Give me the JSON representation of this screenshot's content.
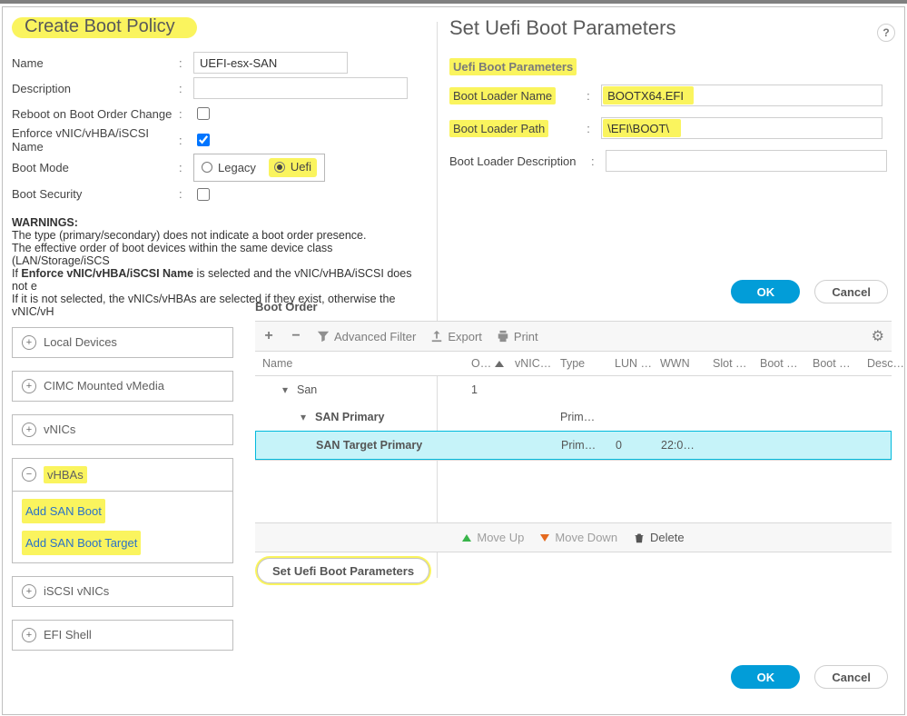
{
  "left": {
    "title": "Create Boot Policy",
    "fields": {
      "name_label": "Name",
      "name_value": "UEFI-esx-SAN",
      "desc_label": "Description",
      "desc_value": "",
      "reboot_label": "Reboot on Boot Order Change",
      "enforce_label": "Enforce vNIC/vHBA/iSCSI Name",
      "bootmode_label": "Boot Mode",
      "bootmode_legacy": "Legacy",
      "bootmode_uefi": "Uefi",
      "bootsec_label": "Boot Security"
    },
    "warnings": {
      "heading": "WARNINGS:",
      "l1": "The type (primary/secondary) does not indicate a boot order presence.",
      "l2": "The effective order of boot devices within the same device class (LAN/Storage/iSCS",
      "l3": "If Enforce vNIC/vHBA/iSCSI Name is selected and the vNIC/vHBA/iSCSI does not e",
      "l4": "If it is not selected, the vNICs/vHBAs are selected if they exist, otherwise the vNIC/vH"
    },
    "acc": {
      "local": "Local Devices",
      "cimc": "CIMC Mounted vMedia",
      "vnics": "vNICs",
      "vhbas": "vHBAs",
      "vhbas_add_boot": "Add SAN Boot",
      "vhbas_add_target": "Add SAN Boot Target",
      "iscsi": "iSCSI vNICs",
      "efi": "EFI Shell"
    }
  },
  "right": {
    "title": "Set Uefi Boot Parameters",
    "section": "Uefi Boot Parameters",
    "rows": {
      "name_label": "Boot Loader Name",
      "name_value": "BOOTX64.EFI",
      "path_label": "Boot Loader Path",
      "path_value": "\\EFI\\BOOT\\",
      "desc_label": "Boot Loader Description",
      "desc_value": ""
    },
    "buttons": {
      "ok": "OK",
      "cancel": "Cancel"
    }
  },
  "boot_order": {
    "title": "Boot Order",
    "toolbar": {
      "advanced_filter": "Advanced Filter",
      "export": "Export",
      "print": "Print"
    },
    "columns": {
      "name": "Name",
      "order": "O…",
      "vnic": "vNIC…",
      "type": "Type",
      "lun": "LUN …",
      "wwn": "WWN",
      "slot": "Slot …",
      "bootn": "Boot …",
      "bootp": "Boot …",
      "desc": "Desc…"
    },
    "rows": {
      "san": {
        "name": "San",
        "order": "1"
      },
      "primary": {
        "name": "SAN Primary",
        "type": "Prim…"
      },
      "target": {
        "name": "SAN Target Primary",
        "type": "Prim…",
        "lun": "0",
        "wwn": "22:0…"
      }
    },
    "movebar": {
      "up": "Move Up",
      "down": "Move Down",
      "delete": "Delete"
    },
    "set_uefi_btn": "Set Uefi Boot Parameters",
    "buttons": {
      "ok": "OK",
      "cancel": "Cancel"
    }
  }
}
